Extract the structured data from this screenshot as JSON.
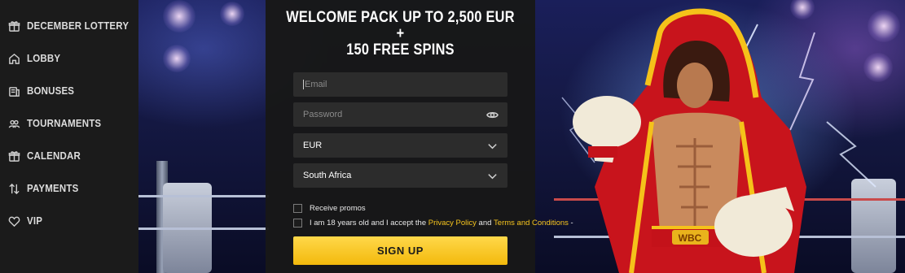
{
  "sidebar": {
    "items": [
      {
        "label": "DECEMBER LOTTERY",
        "icon": "gift-icon"
      },
      {
        "label": "LOBBY",
        "icon": "home-icon"
      },
      {
        "label": "BONUSES",
        "icon": "coins-icon"
      },
      {
        "label": "TOURNAMENTS",
        "icon": "users-icon"
      },
      {
        "label": "CALENDAR",
        "icon": "calendar-gift-icon"
      },
      {
        "label": "PAYMENTS",
        "icon": "transfer-arrows-icon"
      },
      {
        "label": "VIP",
        "icon": "heart-icon"
      }
    ]
  },
  "signup": {
    "title_line1": "WELCOME PACK UP TO 2,500 EUR +",
    "title_line2": "150 FREE SPINS",
    "email_placeholder": "Email",
    "password_placeholder": "Password",
    "currency": "EUR",
    "country": "South Africa",
    "receive_promos": "Receive promos",
    "age_text_start": "I am 18 years old and I accept the ",
    "privacy_policy": "Privacy Policy",
    "and": " and ",
    "terms": "Terms and Conditions",
    "terms_suffix": " -",
    "button": "SIGN UP"
  },
  "banner": {
    "belt_text": "WBC"
  },
  "colors": {
    "accent": "#f7c51e",
    "sidebar_bg": "#1b1b1b",
    "panel_bg": "#181818",
    "field_bg": "#2c2c2c"
  }
}
